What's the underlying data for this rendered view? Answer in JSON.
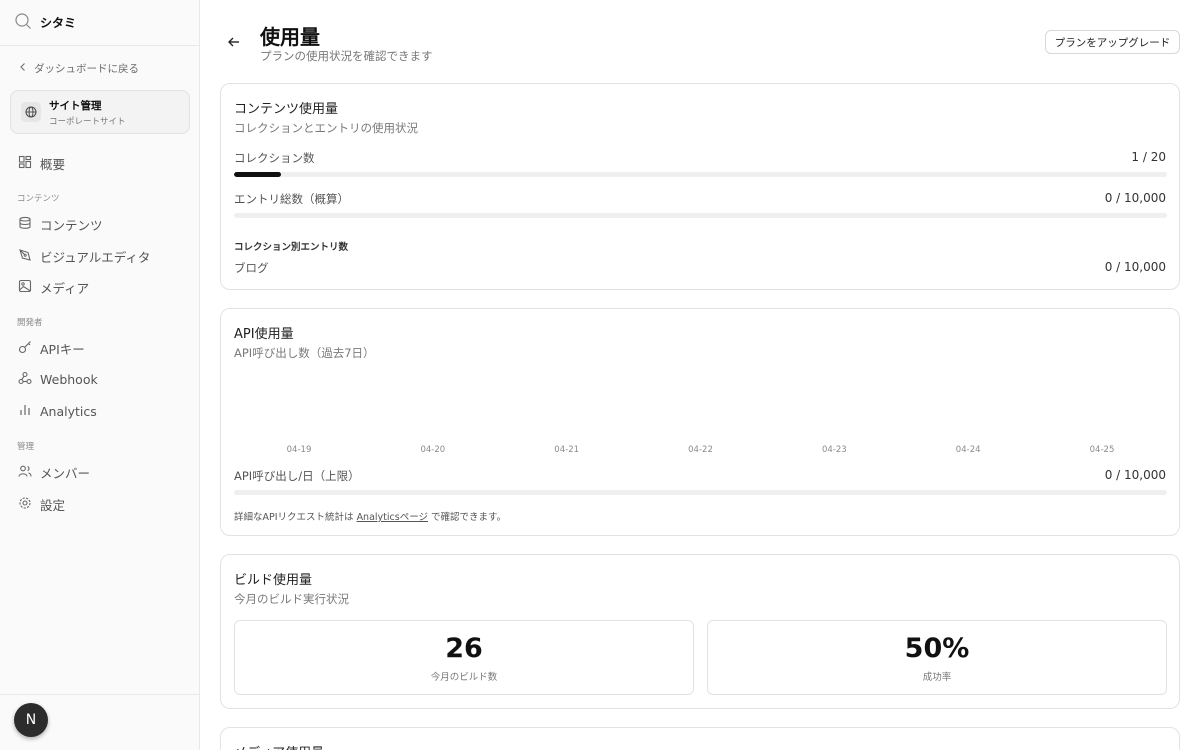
{
  "sidebar": {
    "brand": "シタミ",
    "back_label": "ダッシュボードに戻る",
    "site": {
      "name": "サイト管理",
      "sub": "コーポレートサイト"
    },
    "overview": "概要",
    "sections": {
      "content": "コンテンツ",
      "developer": "開発者",
      "admin": "管理"
    },
    "items": {
      "content": "コンテンツ",
      "visual_editor": "ビジュアルエディタ",
      "media": "メディア",
      "api_keys": "APIキー",
      "webhook": "Webhook",
      "analytics": "Analytics",
      "members": "メンバー",
      "settings": "設定"
    },
    "avatar": "N"
  },
  "header": {
    "title": "使用量",
    "subtitle": "プランの使用状況を確認できます",
    "upgrade_label": "プランをアップグレード"
  },
  "content_usage": {
    "title": "コンテンツ使用量",
    "subtitle": "コレクションとエントリの使用状況",
    "collections_label": "コレクション数",
    "collections_value": "1 / 20",
    "collections_fraction": 0.05,
    "entries_label": "エントリ総数（概算）",
    "entries_value": "0 / 10,000",
    "entries_fraction": 0,
    "per_collection_heading": "コレクション別エントリ数",
    "per_collection": [
      {
        "name": "ブログ",
        "value": "0 / 10,000"
      }
    ]
  },
  "api_usage": {
    "title": "API使用量",
    "subtitle": "API呼び出し数（過去7日）",
    "daily_label": "API呼び出し/日（上限）",
    "daily_value": "0 / 10,000",
    "daily_fraction": 0,
    "note_prefix": "詳細なAPIリクエスト統計は",
    "note_link": "Analyticsページ",
    "note_suffix": "で確認できます。"
  },
  "chart_data": {
    "type": "bar",
    "categories": [
      "04-19",
      "04-20",
      "04-21",
      "04-22",
      "04-23",
      "04-24",
      "04-25"
    ],
    "values": [
      0,
      0,
      0,
      0,
      0,
      0,
      0
    ],
    "title": "",
    "xlabel": "",
    "ylabel": "",
    "grid": false
  },
  "build_usage": {
    "title": "ビルド使用量",
    "subtitle": "今月のビルド実行状況",
    "builds_value": "26",
    "builds_label": "今月のビルド数",
    "success_value": "50%",
    "success_label": "成功率"
  },
  "media_usage": {
    "title": "メディア使用量"
  }
}
